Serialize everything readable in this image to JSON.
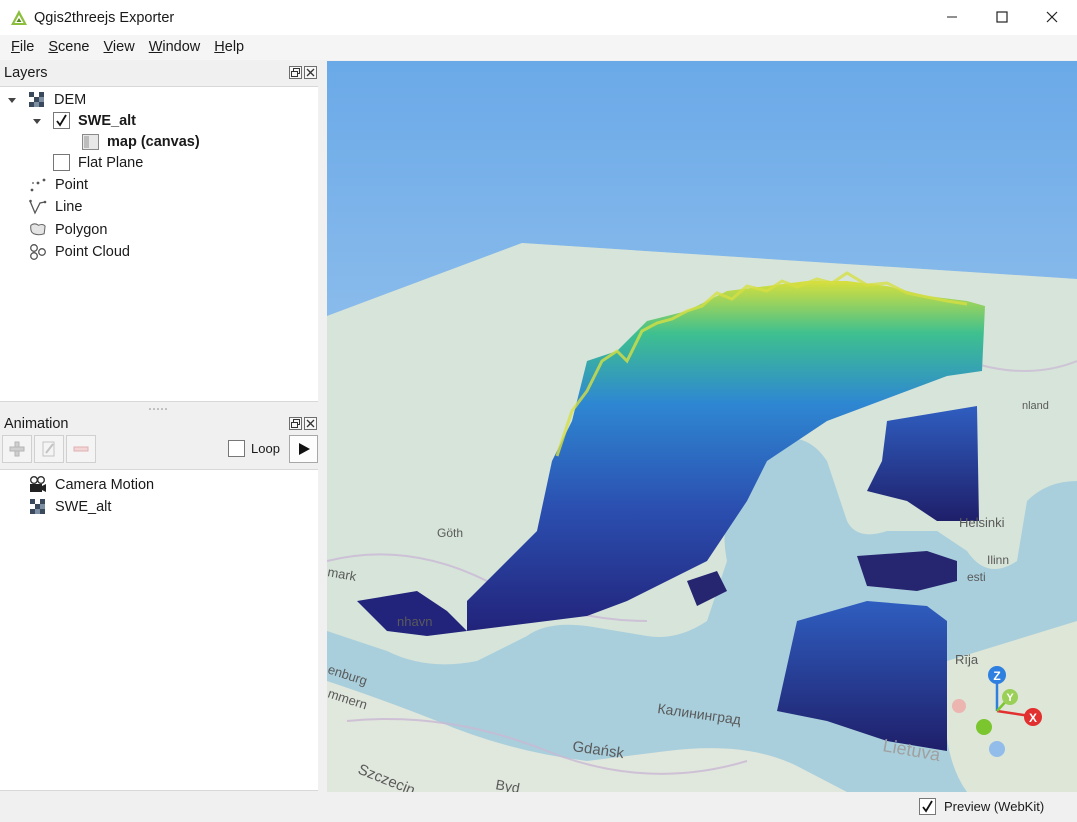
{
  "window": {
    "title": "Qgis2threejs Exporter"
  },
  "menu": {
    "items": [
      {
        "label_u": "F",
        "label_rest": "ile"
      },
      {
        "label_u": "S",
        "label_rest": "cene"
      },
      {
        "label_u": "V",
        "label_rest": "iew"
      },
      {
        "label_u": "W",
        "label_rest": "indow"
      },
      {
        "label_u": "H",
        "label_rest": "elp"
      }
    ]
  },
  "layers_panel": {
    "title": "Layers",
    "items": {
      "dem": "DEM",
      "swe_alt": "SWE_alt",
      "map_canvas": "map (canvas)",
      "flat_plane": "Flat Plane",
      "point": "Point",
      "line": "Line",
      "polygon": "Polygon",
      "point_cloud": "Point Cloud"
    },
    "swe_alt_checked": true,
    "flat_plane_checked": false
  },
  "animation_panel": {
    "title": "Animation",
    "loop_label": "Loop",
    "loop_checked": false,
    "items": {
      "camera_motion": "Camera Motion",
      "swe_alt": "SWE_alt"
    }
  },
  "map_labels": {
    "gdansk": "Gdańsk",
    "kaliningrad": "Калининград",
    "szczecin": "Szczecin",
    "lietuva": "Lietuva",
    "helsinki": "Helsinki",
    "riga": "Rīja",
    "mark": "mark",
    "nhavn": "nhavn",
    "enburg": "enburg",
    "mmern": "mmern",
    "byd": "Byd",
    "goth": "Göth",
    "lnn": "Ilinn",
    "sti": "esti",
    "nland": "nland"
  },
  "axes": {
    "x": "X",
    "y": "Y",
    "z": "Z"
  },
  "status": {
    "preview_label": "Preview (WebKit)",
    "preview_checked": true
  },
  "colors": {
    "sky_top": "#6aa9e8",
    "sky_bottom": "#c8dff2",
    "water": "#a9cfdc",
    "land": "#dfe7d8",
    "terrain_low": "#22237a",
    "terrain_mid": "#2b7fd0",
    "terrain_high": "#e0e33a",
    "axis_x": "#e23030",
    "axis_y": "#7bc62e",
    "axis_z": "#2d7fe0"
  }
}
